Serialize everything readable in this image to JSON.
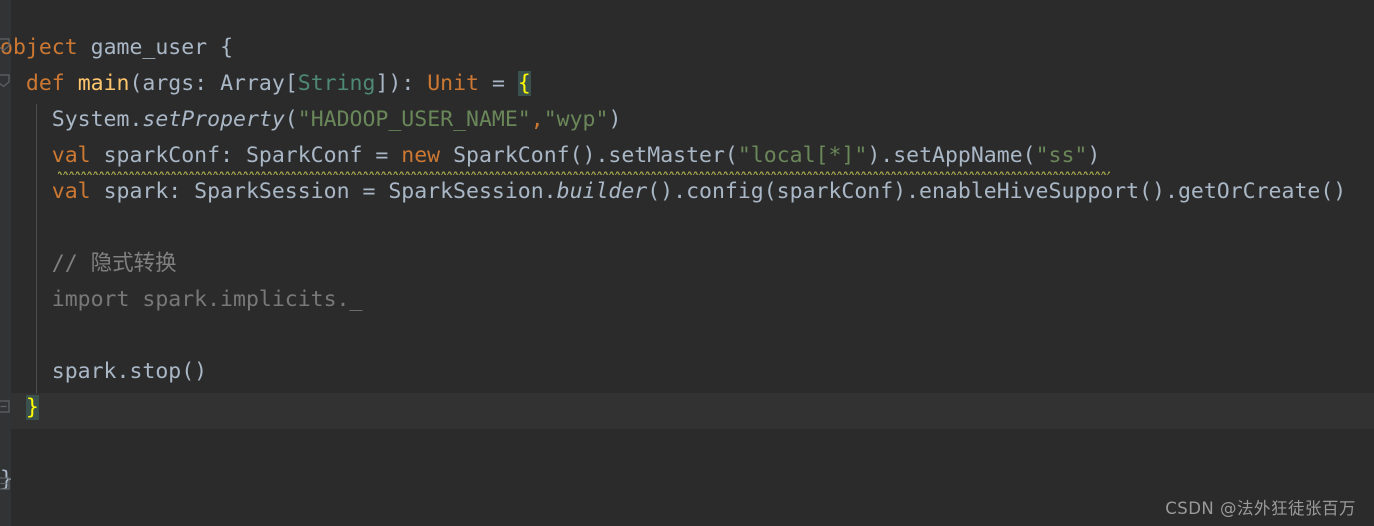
{
  "editor": {
    "language": "Scala",
    "theme": "Darcula",
    "background_color": "#2b2b2b",
    "gutter_color": "#313335",
    "caret_line_color": "#323232",
    "brace_match_color": "#3b514d"
  },
  "colors": {
    "keyword": "#cc7832",
    "function": "#ffc66d",
    "string": "#6a8759",
    "comment": "#808080",
    "identifier": "#a9b7c6",
    "class_type": "#4e8975",
    "brace_highlight_fg": "#ffff00",
    "warning_squiggle": "#a1a14a",
    "grayed_out": "#787878"
  },
  "code": {
    "lines": [
      {
        "n": 1,
        "text": "object game_user {",
        "tokens": [
          {
            "t": "object",
            "c": "kw"
          },
          {
            "t": " ",
            "c": "plain"
          },
          {
            "t": "game_user",
            "c": "ident"
          },
          {
            "t": " {",
            "c": "plain"
          }
        ]
      },
      {
        "n": 2,
        "text": "  def main(args: Array[String]): Unit = {",
        "tokens": [
          {
            "t": "  ",
            "c": "pad"
          },
          {
            "t": "def",
            "c": "kw"
          },
          {
            "t": " ",
            "c": "plain"
          },
          {
            "t": "main",
            "c": "fn"
          },
          {
            "t": "(args: ",
            "c": "plain"
          },
          {
            "t": "Array",
            "c": "plain"
          },
          {
            "t": "[",
            "c": "plain"
          },
          {
            "t": "String",
            "c": "teal"
          },
          {
            "t": "]): ",
            "c": "plain"
          },
          {
            "t": "Unit",
            "c": "kw"
          },
          {
            "t": " = ",
            "c": "plain"
          },
          {
            "t": "{",
            "c": "brace-hl"
          }
        ]
      },
      {
        "n": 3,
        "text": "    System.setProperty(\"HADOOP_USER_NAME\",\"wyp\")",
        "tokens": [
          {
            "t": "    ",
            "c": "pad"
          },
          {
            "t": "System",
            "c": "plain"
          },
          {
            "t": ".",
            "c": "plain"
          },
          {
            "t": "setProperty",
            "c": "plain italic"
          },
          {
            "t": "(",
            "c": "plain"
          },
          {
            "t": "\"HADOOP_USER_NAME\"",
            "c": "str"
          },
          {
            "t": ",",
            "c": "kw"
          },
          {
            "t": "\"wyp\"",
            "c": "str"
          },
          {
            "t": ")",
            "c": "plain"
          }
        ]
      },
      {
        "n": 4,
        "text": "    val sparkConf: SparkConf = new SparkConf().setMaster(\"local[*]\").setAppName(\"ss\")",
        "has_warning": true,
        "tokens": [
          {
            "t": "    ",
            "c": "pad"
          },
          {
            "t": "val",
            "c": "kw"
          },
          {
            "t": " sparkConf: SparkConf = ",
            "c": "plain"
          },
          {
            "t": "new",
            "c": "kw"
          },
          {
            "t": " SparkConf().setMaster(",
            "c": "plain"
          },
          {
            "t": "\"local[*]\"",
            "c": "str"
          },
          {
            "t": ").setAppName(",
            "c": "plain"
          },
          {
            "t": "\"ss\"",
            "c": "str"
          },
          {
            "t": ")",
            "c": "plain"
          }
        ]
      },
      {
        "n": 5,
        "text": "    val spark: SparkSession = SparkSession.builder().config(sparkConf).enableHiveSupport().getOrCreate()",
        "tokens": [
          {
            "t": "    ",
            "c": "pad"
          },
          {
            "t": "val",
            "c": "kw"
          },
          {
            "t": " spark: SparkSession = SparkSession.",
            "c": "plain"
          },
          {
            "t": "builder",
            "c": "plain italic"
          },
          {
            "t": "().config(sparkConf).enableHiveSupport().getOrCreate()",
            "c": "plain"
          }
        ]
      },
      {
        "n": 6,
        "text": "",
        "tokens": []
      },
      {
        "n": 7,
        "text": "    // 隐式转换",
        "tokens": [
          {
            "t": "    ",
            "c": "pad"
          },
          {
            "t": "// 隐式转换",
            "c": "cmt"
          }
        ]
      },
      {
        "n": 8,
        "text": "    import spark.implicits._",
        "tokens": [
          {
            "t": "    ",
            "c": "pad"
          },
          {
            "t": "import spark.implicits._",
            "c": "gray"
          }
        ]
      },
      {
        "n": 9,
        "text": "",
        "tokens": []
      },
      {
        "n": 10,
        "text": "    spark.stop()",
        "tokens": [
          {
            "t": "    ",
            "c": "pad"
          },
          {
            "t": "spark.stop()",
            "c": "plain"
          }
        ]
      },
      {
        "n": 11,
        "text": "  }",
        "is_caret_line": true,
        "tokens": [
          {
            "t": "  ",
            "c": "pad"
          },
          {
            "t": "}",
            "c": "brace-hl"
          }
        ]
      },
      {
        "n": 12,
        "text": "",
        "tokens": []
      },
      {
        "n": 13,
        "text": "}",
        "tokens": [
          {
            "t": "}",
            "c": "plain"
          }
        ]
      }
    ]
  },
  "gutter": {
    "fold_markers": [
      {
        "name": "fold-marker-object",
        "line": 1,
        "state": "expanded"
      },
      {
        "name": "fold-marker-def-main",
        "line": 2,
        "state": "expanded"
      },
      {
        "name": "fold-marker-close-brace",
        "line": 11,
        "state": "expanded"
      },
      {
        "name": "fold-marker-file-end",
        "line": 13,
        "state": "expanded"
      }
    ]
  },
  "watermark": {
    "text": "CSDN @法外狂徒张百万"
  }
}
